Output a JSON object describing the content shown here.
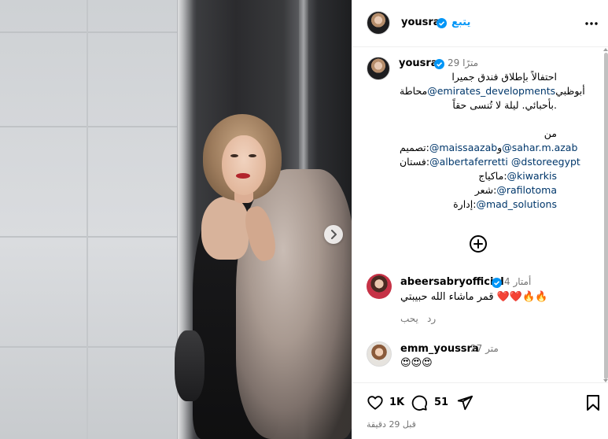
{
  "post": {
    "username": "yousra",
    "follow_label": "يتبع",
    "caption_time": "29 مترًا",
    "caption_lines": [
      "احتفالاً بإطلاق فندق جميرا",
      "@emirates_developments",
      "أبوظبي",
      "محاطة",
      "بأحبائي. ليلة لا تُنسى حقاً."
    ],
    "credits": {
      "from": "من",
      "design_label": "تصميم:",
      "design_mention_1": "@maissaazab",
      "design_and": "و",
      "design_mention_2": "@sahar.m.azab",
      "dress_label": "فستان:",
      "dress_mention_1": "@albertaferretti",
      "dress_mention_2": "@dstoreegypt",
      "makeup_label": "ماكياج:",
      "makeup_mention": "@kiwarkis",
      "hair_label": "شعر:",
      "hair_mention": "@rafilotoma",
      "management_label": "إدارة:",
      "management_mention": "@mad_solutions"
    }
  },
  "comments": [
    {
      "username": "abeersabryofficial",
      "time": "4 أمتار",
      "text": "قمر ماشاء الله حبيبتي ❤️❤️🔥🔥",
      "reply_label": "رد",
      "like_label": "يحب"
    },
    {
      "username": "emm_youssra",
      "time": "27 متر",
      "text": "😍😍😍"
    }
  ],
  "actions": {
    "likes_count": "1K",
    "comments_count": "51",
    "posted_ago": "قبل 29 دقيقة"
  },
  "colors": {
    "link": "#00376b",
    "accent": "#0095f6",
    "muted": "#737373",
    "verified": "#0095f6"
  }
}
